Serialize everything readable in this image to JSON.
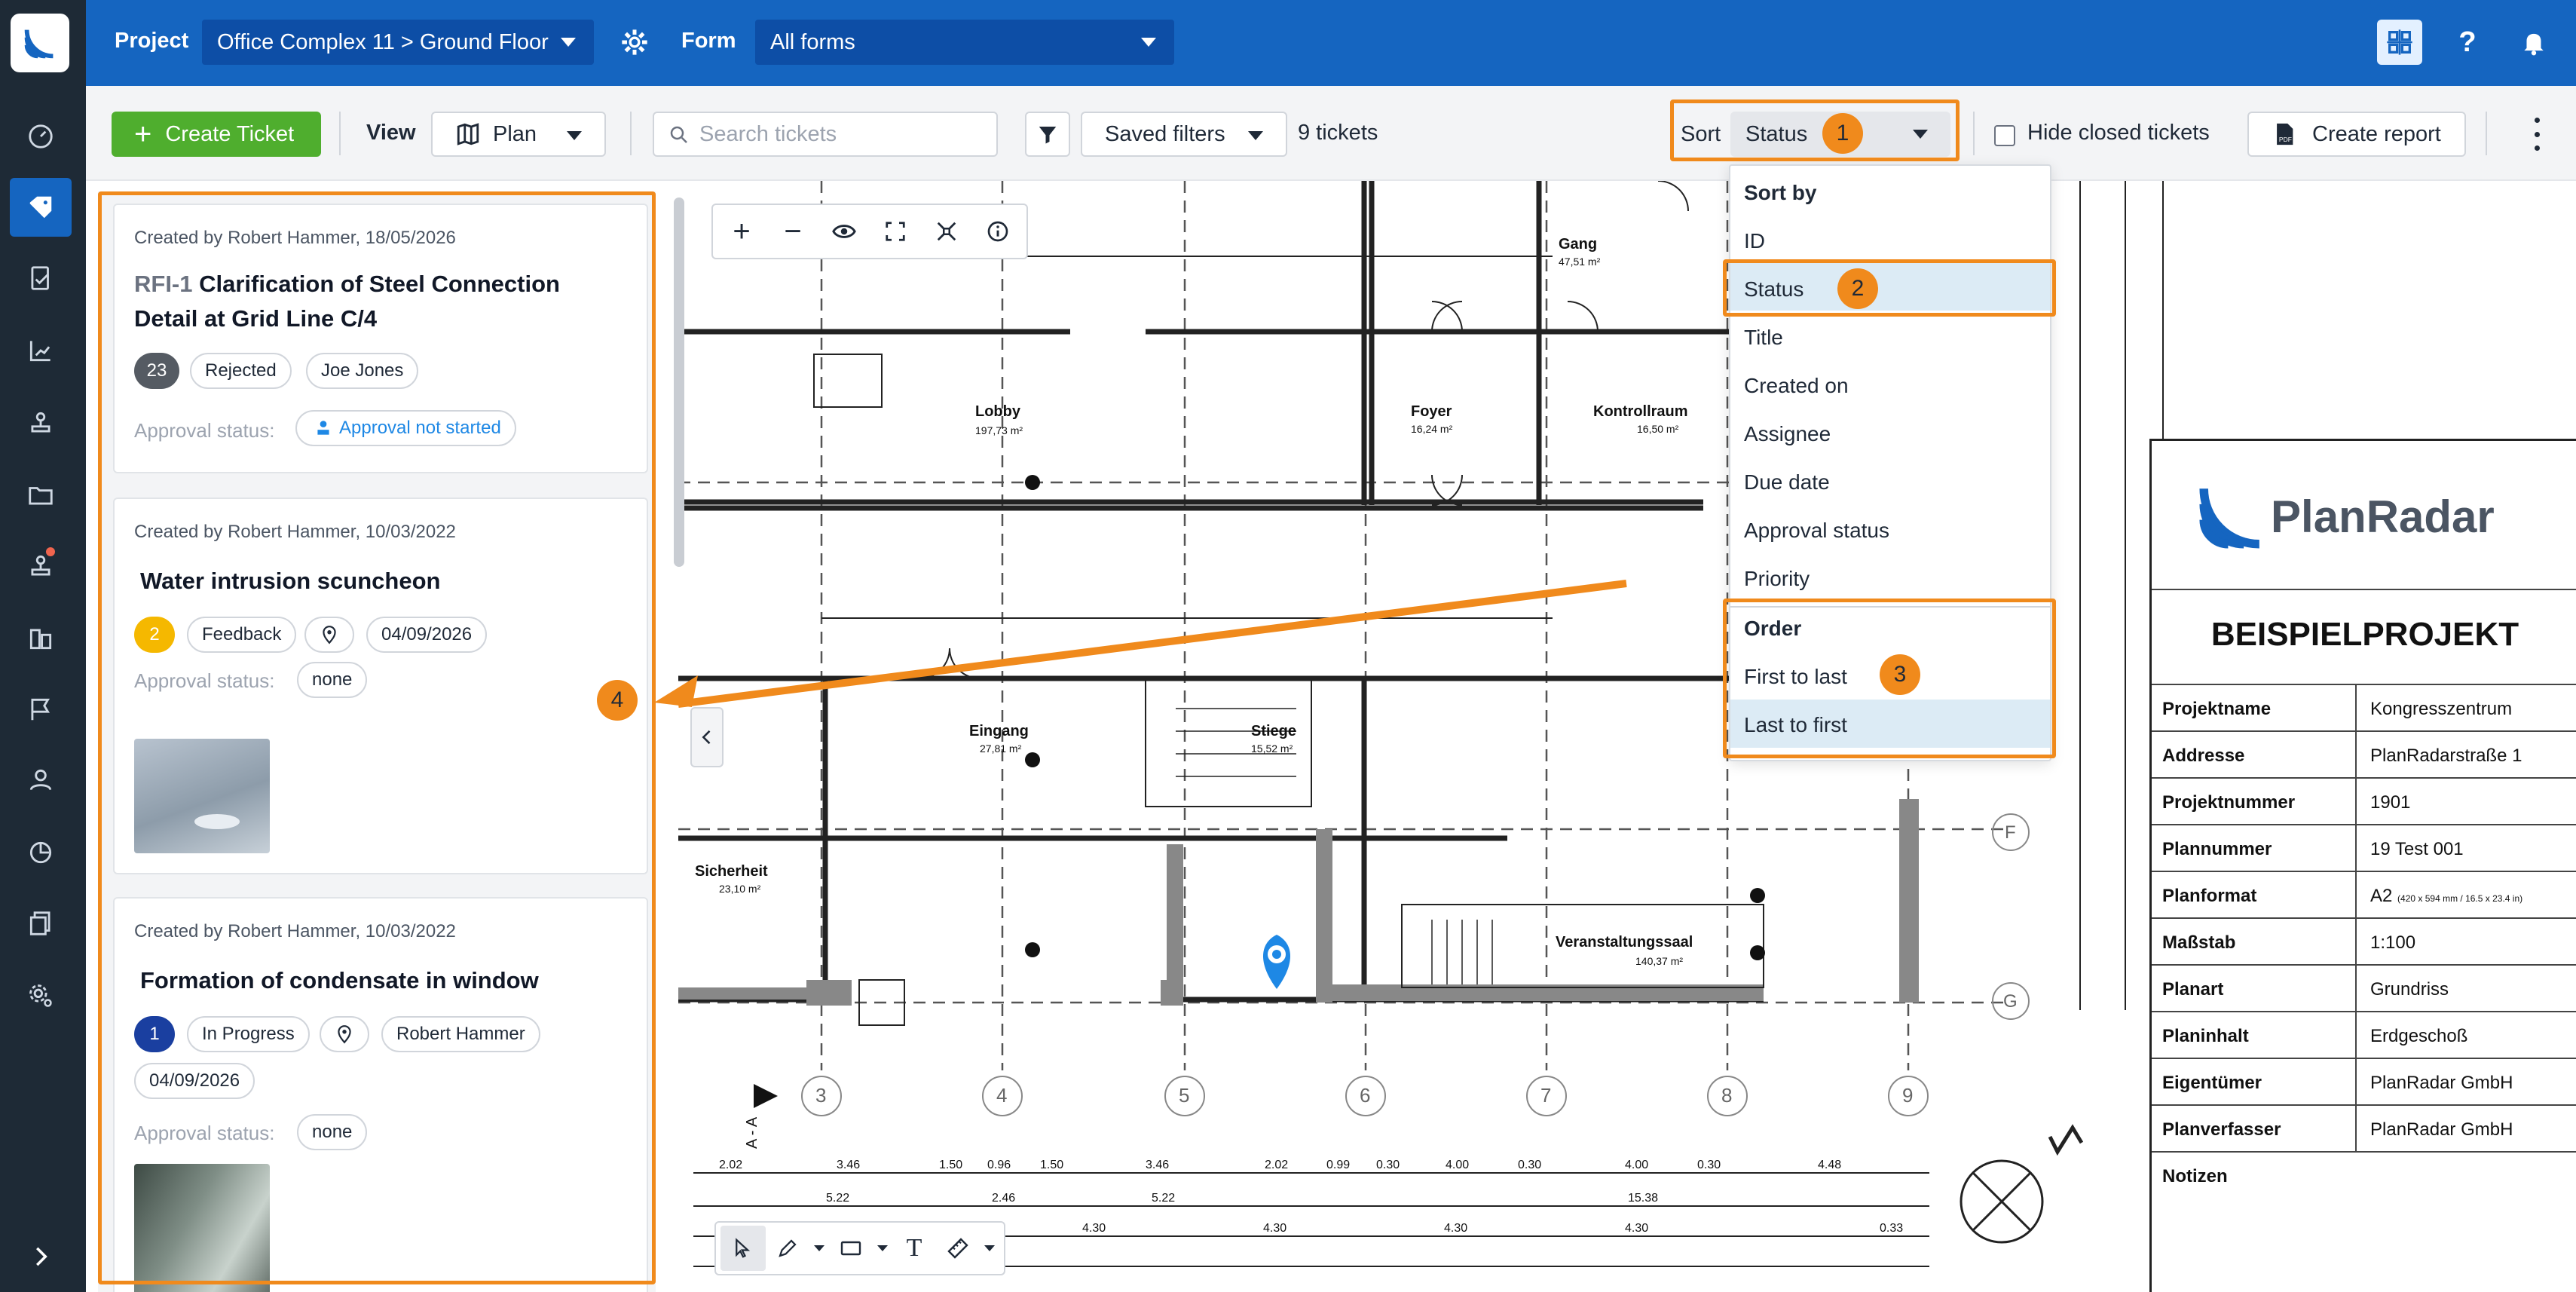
{
  "topbar": {
    "project_label": "Project",
    "project_value": "Office Complex 11 > Ground Floor",
    "form_label": "Form",
    "form_value": "All forms"
  },
  "toolbar": {
    "create_ticket": "Create Ticket",
    "view_label": "View",
    "view_value": "Plan",
    "search_placeholder": "Search tickets",
    "saved_filters": "Saved filters",
    "ticket_count": "9 tickets",
    "sort_label": "Sort",
    "sort_value": "Status",
    "hide_closed": "Hide closed tickets",
    "create_report": "Create report"
  },
  "annotations": {
    "b1": "1",
    "b2": "2",
    "b3": "3",
    "b4": "4"
  },
  "sort_menu": {
    "sort_by_header": "Sort by",
    "items": [
      "ID",
      "Status",
      "Title",
      "Created on",
      "Assignee",
      "Due date",
      "Approval status",
      "Priority"
    ],
    "order_header": "Order",
    "order_items": [
      "First to last",
      "Last to first"
    ],
    "selected_item": "Status",
    "selected_order": "Last to first"
  },
  "tickets": [
    {
      "meta": "Created by Robert Hammer, 18/05/2026",
      "id": "RFI-1",
      "title": "Clarification of Steel Connection Detail at Grid Line C/4",
      "number": "23",
      "status": "Rejected",
      "assignee": "Joe Jones",
      "approval_label": "Approval status:",
      "approval_value": "Approval not started"
    },
    {
      "meta": "Created by Robert Hammer, 10/03/2022",
      "title": "Water intrusion scuncheon",
      "number": "2",
      "status": "Feedback",
      "due": "04/09/2026",
      "approval_label": "Approval status:",
      "approval_value": "none"
    },
    {
      "meta": "Created by Robert Hammer, 10/03/2022",
      "title": "Formation of condensate in window",
      "number": "1",
      "status": "In Progress",
      "assignee": "Robert Hammer",
      "due": "04/09/2026",
      "approval_label": "Approval status:",
      "approval_value": "none"
    }
  ],
  "plan": {
    "rooms": [
      {
        "name": "Lobby",
        "area": "197,73 m²"
      },
      {
        "name": "Gang",
        "area": "47,51 m²"
      },
      {
        "name": "Foyer",
        "area": "16,24 m²"
      },
      {
        "name": "Kontrollraum",
        "area": "16,50 m²"
      },
      {
        "name": "Eingang",
        "area": "27,81 m²"
      },
      {
        "name": "Stiege",
        "area": "15,52 m²"
      },
      {
        "name": "Sicherheit",
        "area": "23,10 m²"
      },
      {
        "name": "Veranstaltungssaal",
        "area": "140,37 m²"
      }
    ],
    "grid_numbers": [
      "3",
      "4",
      "5",
      "6",
      "7",
      "8",
      "9"
    ],
    "grid_letters": [
      "F",
      "G"
    ],
    "section_label": "A - A",
    "dims_row1": [
      "2.02",
      "3.46",
      "1.50",
      "0.96",
      "1.50",
      "3.46",
      "2.02",
      "0.99",
      "0.30",
      "4.00",
      "0.30",
      "4.00",
      "0.30",
      "4.48"
    ],
    "dims_row2": [
      "5.22",
      "2.46",
      "5.22",
      "15.38"
    ],
    "dims_row3": [
      "4.30",
      "4.30",
      "4.30",
      "4.30",
      "0.33"
    ]
  },
  "title_block": {
    "brand": "PlanRadar",
    "project_title": "BEISPIELPROJEKT",
    "rows": [
      {
        "k": "Projektname",
        "v": "Kongresszentrum"
      },
      {
        "k": "Addresse",
        "v": "PlanRadarstraße 1"
      },
      {
        "k": "Projektnummer",
        "v": "1901"
      },
      {
        "k": "Plannummer",
        "v": "19 Test 001"
      },
      {
        "k": "Planformat",
        "v": "A2"
      },
      {
        "k": "Maßstab",
        "v": "1:100"
      },
      {
        "k": "Planart",
        "v": "Grundriss"
      },
      {
        "k": "Planinhalt",
        "v": "Erdgeschoß"
      },
      {
        "k": "Eigentümer",
        "v": "PlanRadar GmbH"
      },
      {
        "k": "Planverfasser",
        "v": "PlanRadar GmbH"
      },
      {
        "k": "Notizen",
        "v": ""
      }
    ],
    "planformat_note": "(420 x 594 mm / 16.5 x 23.4 in)"
  },
  "colors": {
    "primary": "#1565c0",
    "sidebar": "#1e2a36",
    "accent_orange": "#f08a1c",
    "green": "#4fae2e"
  }
}
